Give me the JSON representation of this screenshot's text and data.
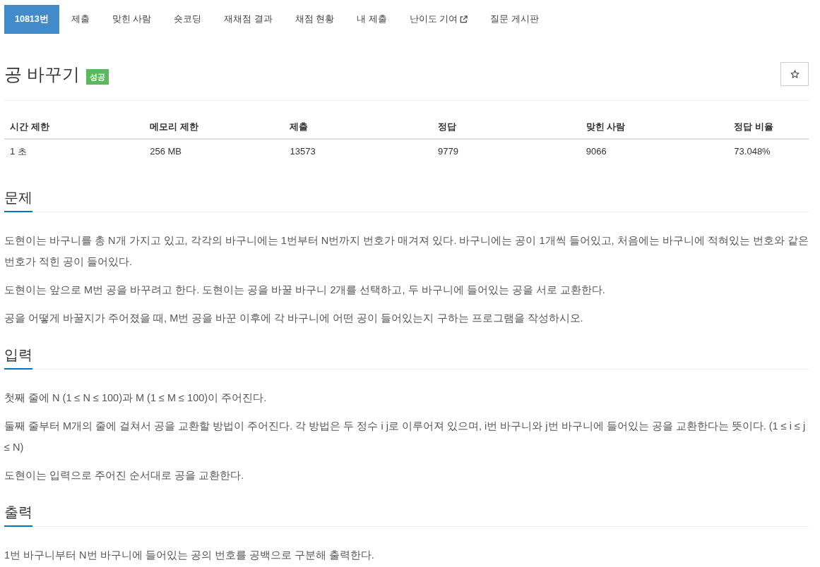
{
  "tabs": [
    {
      "label": "10813번",
      "selected": true,
      "external": false
    },
    {
      "label": "제출",
      "selected": false,
      "external": false
    },
    {
      "label": "맞힌 사람",
      "selected": false,
      "external": false
    },
    {
      "label": "숏코딩",
      "selected": false,
      "external": false
    },
    {
      "label": "재채점 결과",
      "selected": false,
      "external": false
    },
    {
      "label": "채점 현황",
      "selected": false,
      "external": false
    },
    {
      "label": "내 제출",
      "selected": false,
      "external": false
    },
    {
      "label": "난이도 기여",
      "selected": false,
      "external": true
    },
    {
      "label": "질문 게시판",
      "selected": false,
      "external": false
    }
  ],
  "problem": {
    "title": "공 바꾸기",
    "badge": "성공",
    "starred": false
  },
  "stats": {
    "columns": [
      "시간 제한",
      "메모리 제한",
      "제출",
      "정답",
      "맞힌 사람",
      "정답 비율"
    ],
    "rows": [
      [
        "1 초",
        "256 MB",
        "13573",
        "9779",
        "9066",
        "73.048%"
      ]
    ]
  },
  "sections": [
    {
      "heading": "문제",
      "paragraphs": [
        "도현이는 바구니를 총 N개 가지고 있고, 각각의 바구니에는 1번부터 N번까지 번호가 매겨져 있다. 바구니에는 공이 1개씩 들어있고, 처음에는 바구니에 적혀있는 번호와 같은 번호가 적힌 공이 들어있다.",
        "도현이는 앞으로 M번 공을 바꾸려고 한다. 도현이는 공을 바꿀 바구니 2개를 선택하고, 두 바구니에 들어있는 공을 서로 교환한다.",
        "공을 어떻게 바꿀지가 주어졌을 때, M번 공을 바꾼 이후에 각 바구니에 어떤 공이 들어있는지 구하는 프로그램을 작성하시오."
      ]
    },
    {
      "heading": "입력",
      "paragraphs": [
        "첫째 줄에 N (1 ≤ N ≤ 100)과 M (1 ≤ M ≤ 100)이 주어진다.",
        "둘째 줄부터 M개의 줄에 걸쳐서 공을 교환할 방법이 주어진다. 각 방법은 두 정수 i j로 이루어져 있으며, i번 바구니와 j번 바구니에 들어있는 공을 교환한다는 뜻이다. (1 ≤ i ≤ j ≤ N)",
        "도현이는 입력으로 주어진 순서대로 공을 교환한다."
      ]
    },
    {
      "heading": "출력",
      "paragraphs": [
        "1번 바구니부터 N번 바구니에 들어있는 공의 번호를 공백으로 구분해 출력한다."
      ]
    }
  ]
}
